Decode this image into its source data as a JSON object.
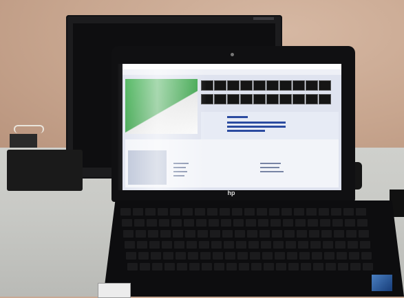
{
  "scene": {
    "laptop_brand_label": "hp"
  },
  "colors": {
    "screen_green": "#45b356",
    "ui_blue": "#2b4ba0"
  }
}
